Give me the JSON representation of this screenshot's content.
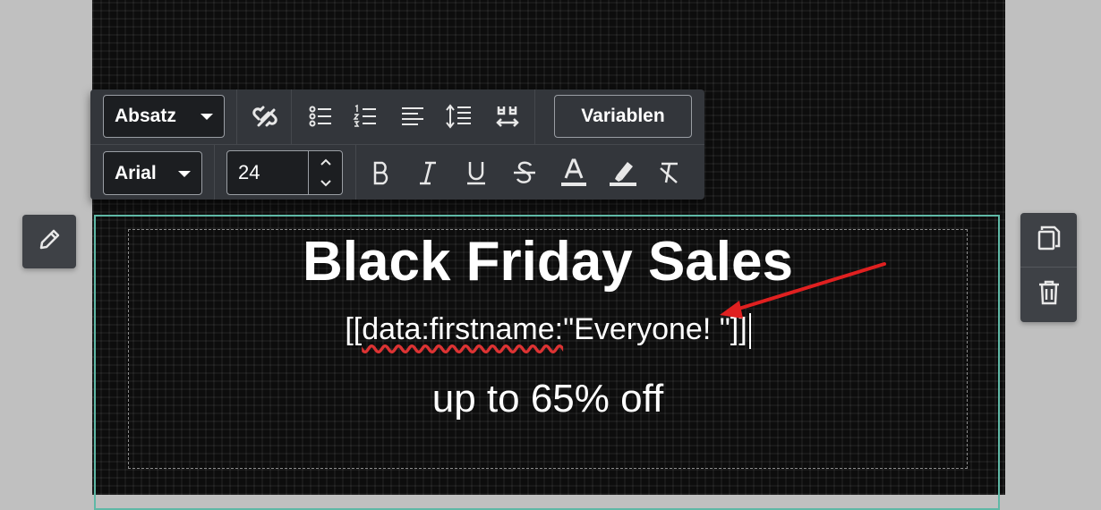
{
  "content": {
    "headline": "Black Friday Sales",
    "variable_open": "[[",
    "variable_spell": "data:firstname:",
    "variable_rest": "\"Everyone! \"]]",
    "subline": "up to 65% off"
  },
  "toolbar": {
    "block_format": "Absatz",
    "font_family": "Arial",
    "font_size": "24",
    "variables_label": "Variablen"
  },
  "icons": {
    "unlink": "unlink-icon",
    "bullets": "bulleted-list-icon",
    "numbered": "numbered-list-icon",
    "align": "align-left-icon",
    "line_height": "line-height-icon",
    "text_direction": "text-direction-icon",
    "bold": "bold-icon",
    "italic": "italic-icon",
    "underline": "underline-icon",
    "strike": "strikethrough-icon",
    "text_color": "text-color-icon",
    "highlight": "highlight-icon",
    "clear_format": "clear-formatting-icon",
    "edit": "pencil-icon",
    "copy": "copy-icon",
    "delete": "trash-icon"
  },
  "colors": {
    "block_border": "#5fb8a6",
    "annotation_arrow": "#e02020",
    "toolbar_bg": "#33363b"
  }
}
